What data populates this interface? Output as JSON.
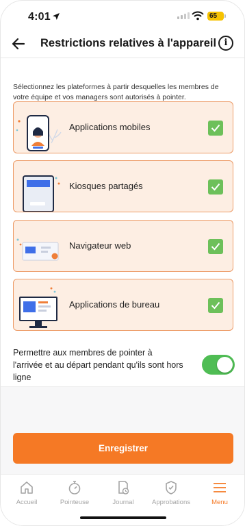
{
  "status": {
    "time": "4:01",
    "battery": "65"
  },
  "header": {
    "title": "Restrictions relatives à l'appareil"
  },
  "description": "Sélectionnez les plateformes à partir desquelles les membres de votre équipe et vos managers sont autorisés à pointer.",
  "platforms": [
    {
      "label": "Applications mobiles",
      "checked": true,
      "illustration": "mobile-illustration"
    },
    {
      "label": "Kiosques partagés",
      "checked": true,
      "illustration": "kiosk-illustration"
    },
    {
      "label": "Navigateur web",
      "checked": true,
      "illustration": "web-browser-illustration"
    },
    {
      "label": "Applications de bureau",
      "checked": true,
      "illustration": "desktop-illustration"
    }
  ],
  "offline": {
    "label": "Permettre aux membres de pointer à l'arrivée et au départ pendant qu'ils sont hors ligne",
    "enabled": true
  },
  "save_label": "Enregistrer",
  "tabs": [
    {
      "label": "Accueil",
      "icon": "home-icon",
      "active": false
    },
    {
      "label": "Pointeuse",
      "icon": "stopwatch-icon",
      "active": false
    },
    {
      "label": "Journal",
      "icon": "journal-icon",
      "active": false
    },
    {
      "label": "Approbations",
      "icon": "shield-check-icon",
      "active": false
    },
    {
      "label": "Menu",
      "icon": "menu-icon",
      "active": true
    }
  ],
  "colors": {
    "accent": "#f57925",
    "card_bg": "#fdeee3",
    "card_border": "#ed9b67",
    "check": "#6dc05a",
    "toggle_on": "#4fbd54"
  }
}
